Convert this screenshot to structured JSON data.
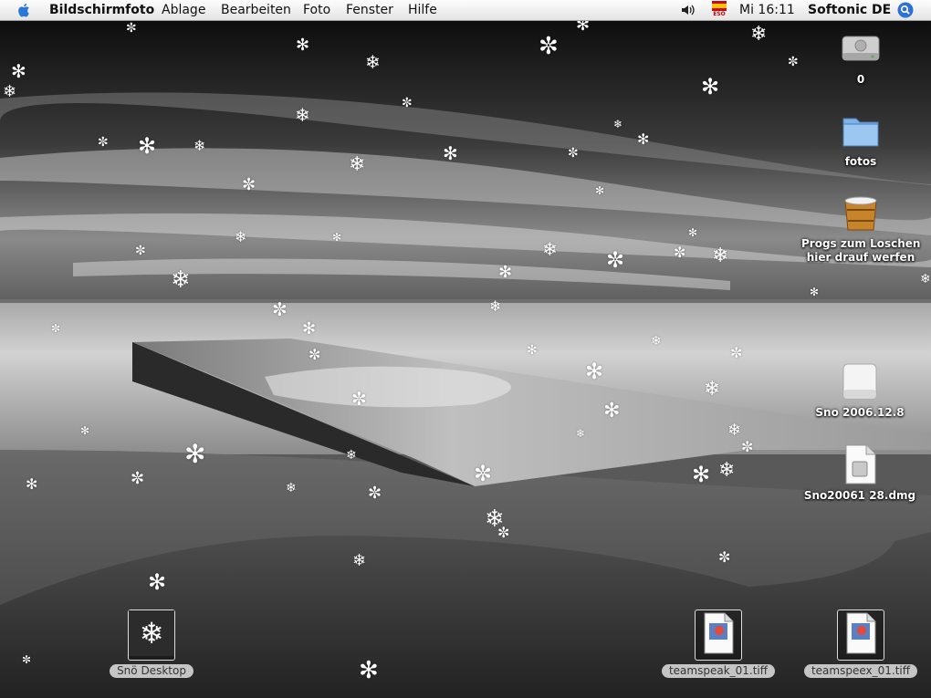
{
  "menubar": {
    "app_name": "Bildschirmfoto",
    "menus": [
      "Ablage",
      "Bearbeiten",
      "Foto",
      "Fenster",
      "Hilfe"
    ],
    "input_flag_label": "ESO",
    "clock": "Mi 16:11",
    "user": "Softonic DE"
  },
  "desktop_icons": {
    "disk": "0",
    "folder": "fotos",
    "trash_line1": "Progs zum Loschen",
    "trash_line2": "hier drauf werfen",
    "volume": "Sno 2006.12.8",
    "dmg": "Sno20061 28.dmg",
    "sno_desktop": "Snö Desktop",
    "tiff_1": "teamspeak_01.tiff",
    "tiff_2": "teamspeex_01.tiff",
    "tiff_badge": "TIFF"
  },
  "colors": {
    "menubar_top": "#fdfdfd",
    "menubar_bottom": "#e4e4e4",
    "spotlight": "#2f6fd8"
  }
}
